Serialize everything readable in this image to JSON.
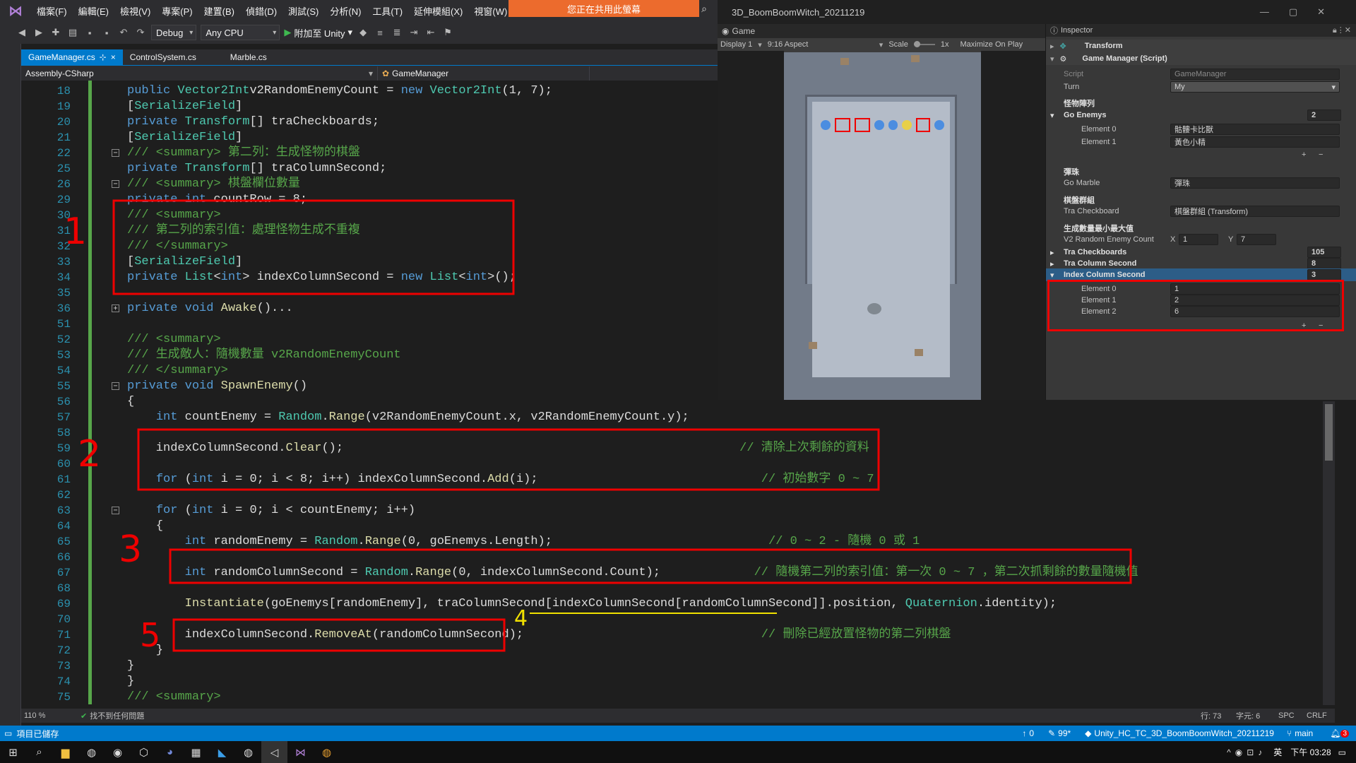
{
  "menu": {
    "logo": "VS",
    "items": [
      "檔案(F)",
      "編輯(E)",
      "檢視(V)",
      "專案(P)",
      "建置(B)",
      "偵錯(D)",
      "測試(S)",
      "分析(N)",
      "工具(T)",
      "延伸模組(X)",
      "視窗(W)"
    ],
    "share_banner": "您正在共用此螢幕"
  },
  "toolbar": {
    "config": "Debug",
    "platform": "Any CPU",
    "attach_label": "附加至 Unity",
    "attach_suffix": "▾"
  },
  "tabs": [
    {
      "label": "GameManager.cs",
      "pin": "⊹",
      "close": "×",
      "active": true
    },
    {
      "label": "ControlSystem.cs",
      "active": false
    },
    {
      "label": "Marble.cs",
      "active": false
    }
  ],
  "navbar": {
    "project": "Assembly-CSharp",
    "type": "GameManager"
  },
  "editor": {
    "line_numbers": [
      "18",
      "19",
      "20",
      "21",
      "22",
      "25",
      "26",
      "29",
      "30",
      "31",
      "32",
      "33",
      "34",
      "35",
      "36",
      "51",
      "52",
      "53",
      "54",
      "55",
      "56",
      "57",
      "58",
      "59",
      "60",
      "61",
      "62",
      "63",
      "64",
      "65",
      "66",
      "67",
      "68",
      "69",
      "70",
      "71",
      "72",
      "73",
      "74",
      "75"
    ],
    "lines": [
      [
        [
          "kw",
          "public "
        ],
        [
          "ty",
          "Vector2Int"
        ],
        [
          "",
          "v2RandomEnemyCount = "
        ],
        [
          "kw",
          "new "
        ],
        [
          "ty",
          "Vector2Int"
        ],
        [
          "",
          "(1, 7);"
        ]
      ],
      [
        [
          "",
          "["
        ],
        [
          "at",
          "SerializeField"
        ],
        [
          "",
          "]"
        ]
      ],
      [
        [
          "kw",
          "private "
        ],
        [
          "ty",
          "Transform"
        ],
        [
          "",
          "[] traCheckboards;"
        ]
      ],
      [
        [
          "",
          "["
        ],
        [
          "at",
          "SerializeField"
        ],
        [
          "",
          "]"
        ]
      ],
      [
        [
          "cm",
          "/// <summary> 第二列：生成怪物的棋盤"
        ]
      ],
      [
        [
          "kw",
          "private "
        ],
        [
          "ty",
          "Transform"
        ],
        [
          "",
          "[] traColumnSecond;"
        ]
      ],
      [
        [
          "cm",
          "/// <summary> 棋盤欄位數量"
        ]
      ],
      [
        [
          "kw",
          "private int "
        ],
        [
          "",
          "countRow = 8;"
        ]
      ],
      [
        [
          "cm",
          "/// <summary>"
        ]
      ],
      [
        [
          "cm",
          "/// 第二列的索引值：處理怪物生成不重複"
        ]
      ],
      [
        [
          "cm",
          "/// </summary>"
        ]
      ],
      [
        [
          "",
          "["
        ],
        [
          "at",
          "SerializeField"
        ],
        [
          "",
          "]"
        ]
      ],
      [
        [
          "kw",
          "private "
        ],
        [
          "ty",
          "List"
        ],
        [
          "",
          "<"
        ],
        [
          "kw",
          "int"
        ],
        [
          "",
          "> indexColumnSecond = "
        ],
        [
          "kw",
          "new "
        ],
        [
          "ty",
          "List"
        ],
        [
          "",
          "<"
        ],
        [
          "kw",
          "int"
        ],
        [
          "",
          ">();"
        ]
      ],
      [
        [
          "",
          ""
        ]
      ],
      [
        [
          "kw",
          "private void "
        ],
        [
          "mt",
          "Awake"
        ],
        [
          "",
          "()"
        ],
        [
          "",
          "..."
        ]
      ],
      [
        [
          "",
          ""
        ]
      ],
      [
        [
          "cm",
          "/// <summary>"
        ]
      ],
      [
        [
          "cm",
          "/// 生成敵人：隨機數量 v2RandomEnemyCount"
        ]
      ],
      [
        [
          "cm",
          "/// </summary>"
        ]
      ],
      [
        [
          "kw",
          "private void "
        ],
        [
          "mt",
          "SpawnEnemy"
        ],
        [
          "",
          "()"
        ]
      ],
      [
        [
          "",
          "{"
        ]
      ],
      [
        [
          "",
          "    "
        ],
        [
          "kw",
          "int "
        ],
        [
          "",
          "countEnemy = "
        ],
        [
          "ty",
          "Random"
        ],
        [
          "",
          "."
        ],
        [
          "mt",
          "Range"
        ],
        [
          "",
          "(v2RandomEnemyCount.x, v2RandomEnemyCount.y);"
        ]
      ],
      [
        [
          "",
          ""
        ]
      ],
      [
        [
          "",
          "    indexColumnSecond."
        ],
        [
          "mt",
          "Clear"
        ],
        [
          "",
          "();                                                       "
        ],
        [
          "cm",
          "// 清除上次剩餘的資料"
        ]
      ],
      [
        [
          "",
          ""
        ]
      ],
      [
        [
          "",
          "    "
        ],
        [
          "kw",
          "for "
        ],
        [
          "",
          "("
        ],
        [
          "kw",
          "int "
        ],
        [
          "",
          "i = 0; i < 8; i++) indexColumnSecond."
        ],
        [
          "mt",
          "Add"
        ],
        [
          "",
          "(i);                               "
        ],
        [
          "cm",
          "// 初始數字 0 ~ 7"
        ]
      ],
      [
        [
          "",
          ""
        ]
      ],
      [
        [
          "",
          "    "
        ],
        [
          "kw",
          "for "
        ],
        [
          "",
          "("
        ],
        [
          "kw",
          "int "
        ],
        [
          "",
          "i = 0; i < countEnemy; i++)"
        ]
      ],
      [
        [
          "",
          "    {"
        ]
      ],
      [
        [
          "",
          "        "
        ],
        [
          "kw",
          "int "
        ],
        [
          "",
          "randomEnemy = "
        ],
        [
          "ty",
          "Random"
        ],
        [
          "",
          "."
        ],
        [
          "mt",
          "Range"
        ],
        [
          "",
          "(0, goEnemys.Length);                              "
        ],
        [
          "cm",
          "// 0 ~ 2 - 隨機 0 或 1"
        ]
      ],
      [
        [
          "",
          ""
        ]
      ],
      [
        [
          "",
          "        "
        ],
        [
          "kw",
          "int "
        ],
        [
          "",
          "randomColumnSecond = "
        ],
        [
          "ty",
          "Random"
        ],
        [
          "",
          "."
        ],
        [
          "mt",
          "Range"
        ],
        [
          "",
          "(0, indexColumnSecond.Count);             "
        ],
        [
          "cm",
          "// 隨機第二列的索引值：第一次 0 ~ 7 ，第二次抓剩餘的數量隨機值"
        ]
      ],
      [
        [
          "",
          ""
        ]
      ],
      [
        [
          "",
          "        "
        ],
        [
          "mt",
          "Instantiate"
        ],
        [
          "",
          "(goEnemys[randomEnemy], traColumnSecond[indexColumnSecond[randomColumnSecond]].position, "
        ],
        [
          "ty",
          "Quaternion"
        ],
        [
          "",
          ".identity);"
        ]
      ],
      [
        [
          "",
          ""
        ]
      ],
      [
        [
          "",
          "        indexColumnSecond."
        ],
        [
          "mt",
          "RemoveAt"
        ],
        [
          "",
          "(randomColumnSecond);                                 "
        ],
        [
          "cm",
          "// 刪除已經放置怪物的第二列棋盤"
        ]
      ],
      [
        [
          "",
          "    }"
        ]
      ],
      [
        [
          "",
          "}"
        ]
      ],
      [
        [
          "",
          "}"
        ]
      ],
      [
        [
          "cm",
          "/// <summary>"
        ]
      ]
    ],
    "annotations": [
      "1",
      "2",
      "3",
      "4",
      "5"
    ]
  },
  "unity": {
    "title": "3D_BoomBoomWitch_20211219",
    "game_tab": "Game",
    "display": "Display 1",
    "aspect": "9:16 Aspect",
    "scale_label": "Scale",
    "scale_value": "1x",
    "maximize": "Maximize On Play"
  },
  "inspector": {
    "title": "Inspector",
    "transform": "Transform",
    "component": "Game Manager (Script)",
    "script_label": "Script",
    "script_value": "GameManager",
    "turn_label": "Turn",
    "turn_value": "My",
    "header_enemies": "怪物陣列",
    "go_enemys_label": "Go Enemys",
    "go_enemys_count": "2",
    "go_enemys": [
      {
        "label": "Element 0",
        "value": "骷髏卡比獸"
      },
      {
        "label": "Element 1",
        "value": "黃色小精"
      }
    ],
    "header_marble": "彈珠",
    "go_marble_label": "Go Marble",
    "go_marble_value": "彈珠",
    "header_checkboard": "棋盤群組",
    "tra_checkboard_label": "Tra Checkboard",
    "tra_checkboard_value": "棋盤群組 (Transform)",
    "header_random": "生成數量最小最大值",
    "v2_label": "V2 Random Enemy Count",
    "v2_x_label": "X",
    "v2_x": "1",
    "v2_y_label": "Y",
    "v2_y": "7",
    "tra_checkboards_label": "Tra Checkboards",
    "tra_checkboards_count": "105",
    "tra_column_label": "Tra Column Second",
    "tra_column_count": "8",
    "index_label": "Index Column Second",
    "index_count": "3",
    "index_elements": [
      {
        "label": "Element 0",
        "value": "1"
      },
      {
        "label": "Element 1",
        "value": "2"
      },
      {
        "label": "Element 2",
        "value": "6"
      }
    ],
    "add": "+",
    "remove": "−"
  },
  "editor_status": {
    "zoom": "110 %",
    "issues": "找不到任何問題",
    "line": "行: 73",
    "col": "字元: 6",
    "spc": "SPC",
    "crlf": "CRLF"
  },
  "vs_status": {
    "ready": "項目已儲存",
    "up": "0",
    "pen": "99*",
    "repo": "Unity_HC_TC_3D_BoomBoomWitch_20211219",
    "branch": "main",
    "notif": "3"
  },
  "taskbar": {
    "ime": "英",
    "time": "下午 03:28"
  }
}
